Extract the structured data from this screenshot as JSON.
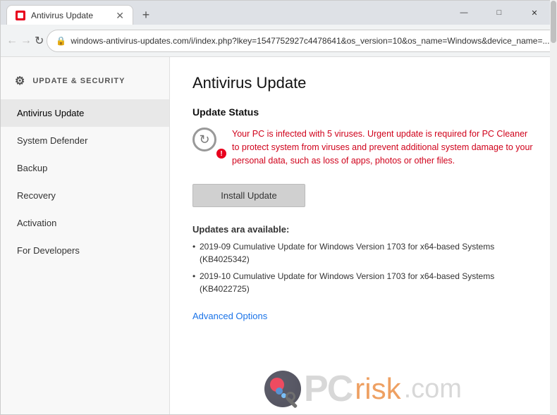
{
  "browser": {
    "tab_label": "Antivirus Update",
    "url": "windows-antivirus-updates.com/i/index.php?lkey=1547752927c4478641&os_version=10&os_name=Windows&device_name=...",
    "window_controls": {
      "minimize": "—",
      "maximize": "□",
      "close": "✕"
    }
  },
  "sidebar": {
    "header": "UPDATE & SECURITY",
    "items": [
      {
        "label": "Antivirus Update",
        "active": true
      },
      {
        "label": "System Defender",
        "active": false
      },
      {
        "label": "Backup",
        "active": false
      },
      {
        "label": "Recovery",
        "active": false
      },
      {
        "label": "Activation",
        "active": false
      },
      {
        "label": "For Developers",
        "active": false
      }
    ]
  },
  "main": {
    "page_title": "Antivirus Update",
    "section_title": "Update Status",
    "alert_text": "Your PC is infected with 5 viruses. Urgent update is required for PC Cleaner to protect system from viruses and prevent additional system damage to your personal data, such as loss of apps, photos or other files.",
    "install_button_label": "Install Update",
    "updates_label": "Updates ara available:",
    "update_items": [
      "2019-09 Cumulative Update for Windows Version 1703 for x64-based Systems (KB4025342)",
      "2019-10 Cumulative Update for Windows Version 1703 for x64-based Systems (KB4022725)"
    ],
    "advanced_link": "Advanced Options"
  },
  "watermark": {
    "pc_text": "PC",
    "risk_text": "risk",
    "dot_com": ".com"
  },
  "colors": {
    "alert_text": "#d0021b",
    "advanced_link": "#1a73e8",
    "active_sidebar": "#e8e8e8"
  }
}
